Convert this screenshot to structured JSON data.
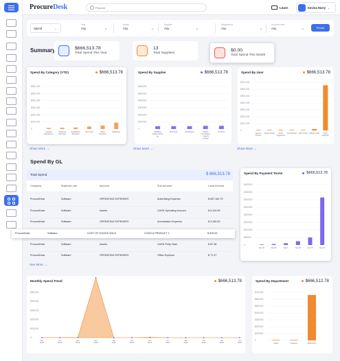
{
  "app": {
    "logo_a": "Procure",
    "logo_b": "Desk"
  },
  "search": {
    "placeholder": "Procure"
  },
  "header": {
    "learn_label": "Learn",
    "user_name": "Kevina Hurry"
  },
  "filters": {
    "spend_label": "Spend",
    "fields": [
      {
        "label": "Year",
        "value": "Any"
      },
      {
        "label": "Month",
        "value": "Any"
      },
      {
        "label": "Supplier",
        "value": "Any"
      },
      {
        "label": "Department",
        "value": "Any"
      },
      {
        "label": "Account code",
        "value": "Any"
      }
    ],
    "period_label": "Period"
  },
  "summary": {
    "title": "Summary",
    "cards": [
      {
        "value": "$666,513.78",
        "label": "Total Spend This Year",
        "icon": "dollar-card-icon",
        "color": "#3f6fe8"
      },
      {
        "value": "13",
        "label": "Total Suppliers",
        "icon": "supplier-icon",
        "color": "#f28a2e"
      },
      {
        "value": "$0.00",
        "label": "Total Spend This Month",
        "icon": "calendar-dollar-icon",
        "color": "#ef5a5a"
      }
    ]
  },
  "charts": {
    "by_category": {
      "title": "Spend By Category (YTD)",
      "total": "$666,513.78",
      "ticks": [
        "$600,000",
        "$500,000",
        "$400,000",
        "$300,000",
        "$200,000",
        "$100,000",
        "0"
      ]
    },
    "by_supplier": {
      "title": "Spend By Supplier",
      "total": "$666,513.78",
      "ticks": [
        "$600000",
        "$500000",
        "$400000",
        "$300000",
        "$200000",
        "$100000",
        "0"
      ]
    },
    "by_user": {
      "title": "Spend By User",
      "total": "$666,513.78",
      "ticks": [
        "$700,000",
        "$600,000",
        "$500,000",
        "$400,000",
        "$300,000",
        "$200,000",
        "$100,000",
        "0"
      ]
    },
    "payment_terms": {
      "title": "Spend By Payment Terms",
      "total": "$666,512.78",
      "ticks": [
        "$400000",
        "$350000",
        "$300000",
        "$250000",
        "$200000",
        "$150000",
        "$100000",
        "$50000",
        "0"
      ]
    },
    "monthly": {
      "title": "Monthly Spend Trend",
      "total": "$666,513.78",
      "ticks": [
        "$500000",
        "$400000",
        "$300000",
        "$200000",
        "$100000",
        "0"
      ]
    },
    "by_department": {
      "title": "Spend By Department",
      "total": "$666,512.78",
      "ticks": [
        "$700000",
        "$600000",
        "$500000",
        "$400000",
        "$300000",
        "$200000",
        "$100000",
        "0"
      ]
    }
  },
  "show_more": "Show More →",
  "see_more": "See More →",
  "gl": {
    "title": "Spend By GL",
    "total_label": "Total Spend",
    "total_value": "$ 666,513.78",
    "columns": [
      "Company",
      "Business unit",
      "Account",
      "Sub Account",
      "Local Amount"
    ],
    "rows": [
      [
        "ProcureDesk",
        "Software",
        "OPERATING EXPENSES",
        "Advertising Expense",
        "$ 657,164.75"
      ],
      [
        "ProcureDesk",
        "Software",
        "Assets",
        "CASH Operating Account",
        "$ 5,104.90"
      ],
      [
        "ProcureDesk",
        "Software",
        "OPERATING EXPENSES",
        "Amortization Expense",
        "$ 3,150.00"
      ],
      [
        "ProcureDesk",
        "Software",
        "COST OF GOODS SOLD",
        "COGS & PRODUCT 1",
        "$ 878.00"
      ],
      [
        "ProcureDesk",
        "Software",
        "Assets",
        "CASH Petty Cash",
        "$ 87.38"
      ],
      [
        "ProcureDesk",
        "Software",
        "OPERATING EXPENSES",
        "Office Expense",
        "$ 71.47"
      ]
    ]
  },
  "chart_data": [
    {
      "type": "bar",
      "title": "Spend By Category (YTD)",
      "categories": [
        "Capital Equipment",
        "Shipping Services",
        "Application Software",
        "Unit Tests",
        "Office Supplies",
        "Hardware"
      ],
      "values": [
        15000,
        18000,
        22000,
        35000,
        50000,
        90000
      ],
      "ylim": [
        0,
        600000
      ]
    },
    {
      "type": "bar",
      "title": "Spend By Supplier",
      "categories": [
        "Building Maintenance Inc",
        "Bunnell's",
        "Mediaware",
        "Vendor Foundation - ABCD Limited",
        "Amazon"
      ],
      "values": [
        40000,
        40000,
        40000,
        45000,
        45000
      ],
      "ylim": [
        0,
        600000
      ]
    },
    {
      "type": "bar",
      "title": "Spend By User",
      "categories": [
        "Aparna Kumar",
        "Mohit Singh",
        "Ankit Aggarwal",
        "Purchasing",
        "Abhi Shek",
        "ABCD 1234",
        "John Hoffman"
      ],
      "values": [
        2000,
        1000,
        2000,
        2000,
        3000,
        20000,
        657000
      ],
      "ylim": [
        0,
        700000
      ]
    },
    {
      "type": "bar",
      "title": "Spend By Payment Terms",
      "categories": [
        "Net 30",
        "Net 60",
        "Net 1",
        "Net 45",
        "Net 15",
        "Net 60"
      ],
      "values": [
        3000,
        6000,
        12000,
        25000,
        50000,
        315000
      ],
      "ylim": [
        0,
        400000
      ]
    },
    {
      "type": "area",
      "title": "Monthly Spend Trend",
      "x": [
        "Jan 2018",
        "Jun 2018",
        "Jan 2019",
        "Jun 2019",
        "Jan 2020",
        "Jun 2020",
        "Jan 2021",
        "Jun 2021",
        "Jan 2022",
        "Jun 2022",
        "Jan 2023",
        "Jun 2023"
      ],
      "y": [
        500,
        1000,
        2000,
        660000,
        0,
        0,
        3000,
        0,
        0,
        0,
        0,
        0
      ],
      "ylim": [
        0,
        500000
      ]
    },
    {
      "type": "bar",
      "title": "Spend By Department",
      "categories": [
        "Sales",
        "Finance",
        "Marketing"
      ],
      "values": [
        3000,
        1000,
        662000
      ],
      "ylim": [
        0,
        700000
      ]
    }
  ]
}
